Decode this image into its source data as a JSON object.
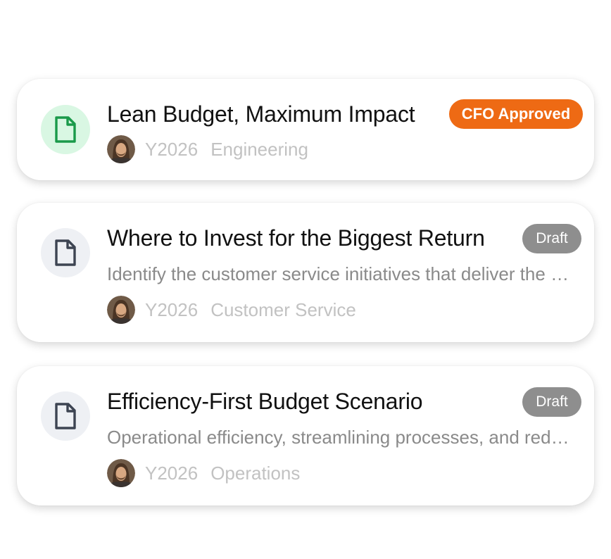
{
  "cards": [
    {
      "title": "Lean Budget, Maximum Impact",
      "badge": "CFO Approved",
      "badge_color": "#ee6a14",
      "icon": "document-icon",
      "icon_color": "#1a9a4a",
      "year": "Y2026",
      "department": "Engineering"
    },
    {
      "title": "Where to Invest for the Biggest Return",
      "badge": "Draft",
      "badge_color": "#8e8e8e",
      "icon": "document-icon",
      "icon_color": "#3d4452",
      "description": "Identify the customer service initiatives that deliver the most value",
      "year": "Y2026",
      "department": "Customer Service"
    },
    {
      "title": "Efficiency-First Budget Scenario",
      "badge": "Draft",
      "badge_color": "#8e8e8e",
      "icon": "document-icon",
      "icon_color": "#3d4452",
      "description": "Operational efficiency, streamlining processes, and reducing costs",
      "year": "Y2026",
      "department": "Operations"
    }
  ]
}
